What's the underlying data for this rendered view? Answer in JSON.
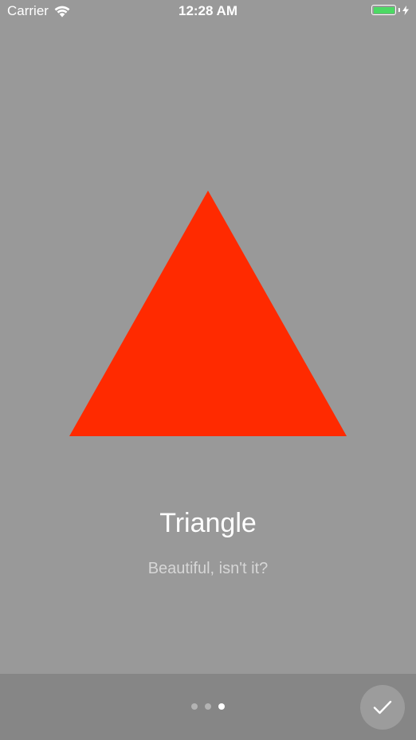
{
  "status_bar": {
    "carrier": "Carrier",
    "time": "12:28 AM",
    "battery_color": "#4cd964"
  },
  "slide": {
    "shape_color": "#ff2a00",
    "title": "Triangle",
    "subtitle": "Beautiful, isn't it?"
  },
  "pager": {
    "page_count": 3,
    "current_page": 3
  },
  "icons": {
    "wifi": "wifi-icon",
    "battery": "battery-icon",
    "charging": "bolt-icon",
    "done": "check-icon"
  }
}
